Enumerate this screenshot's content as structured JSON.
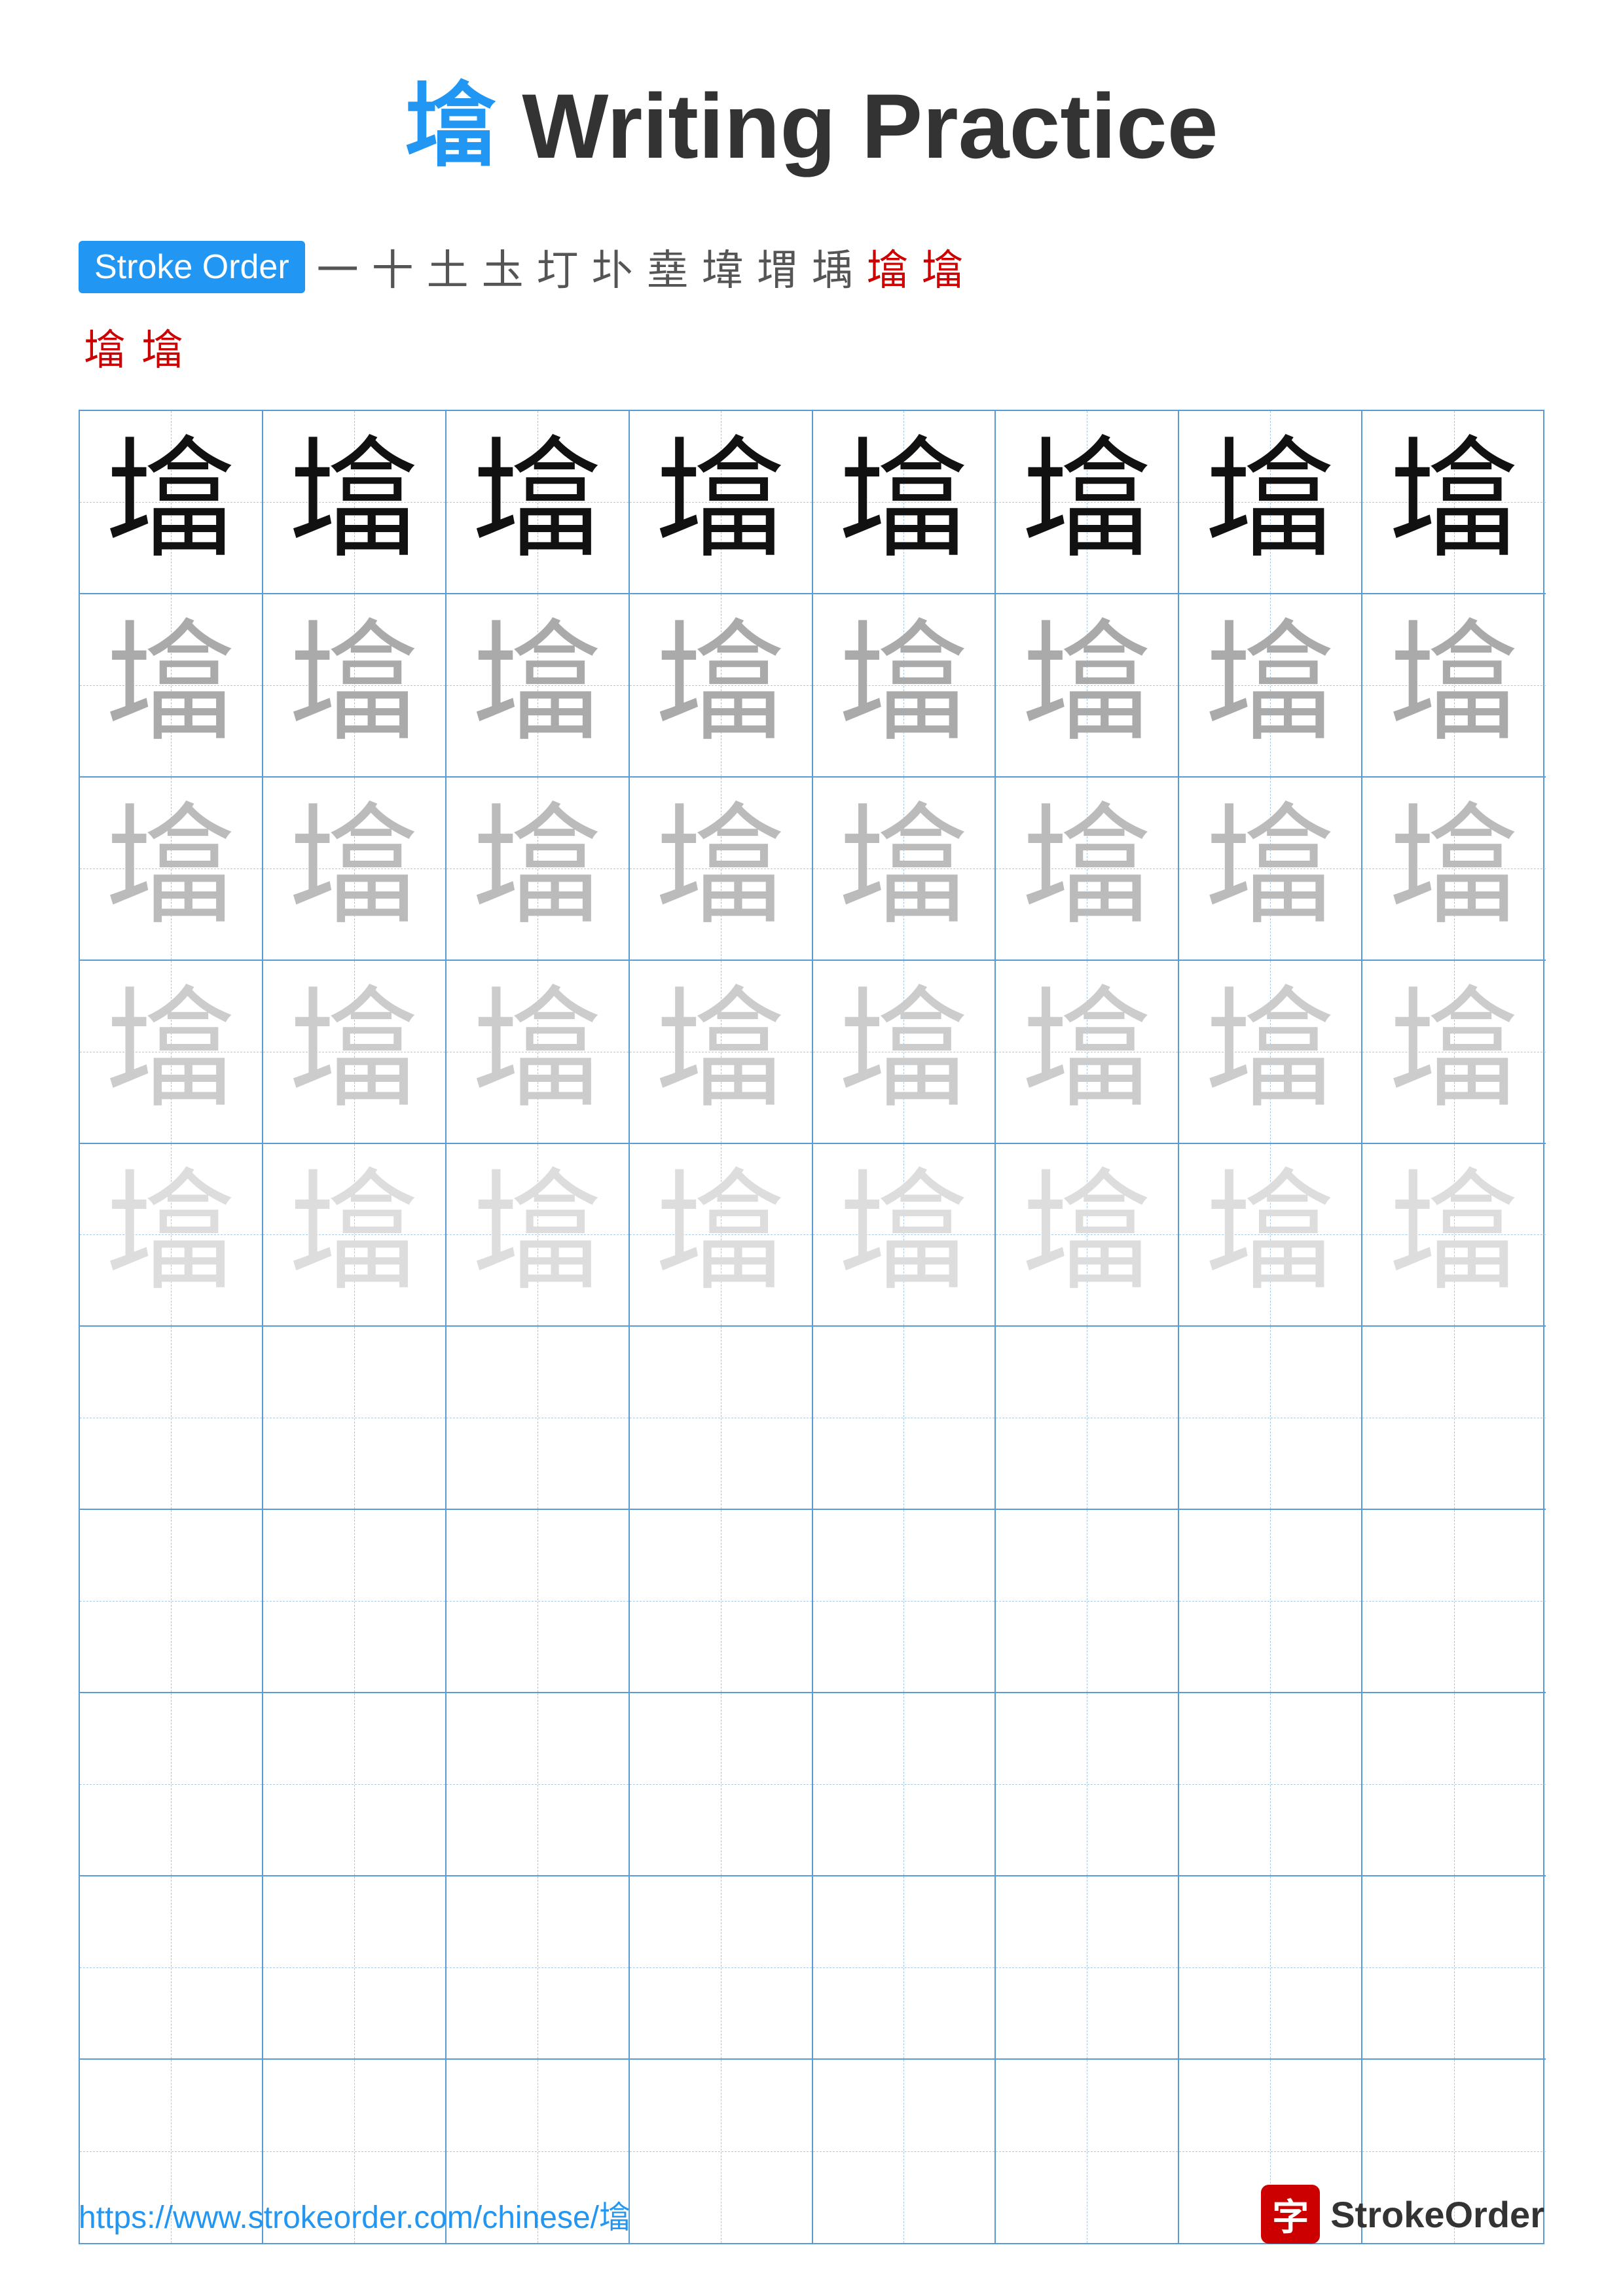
{
  "title": {
    "char": "墖",
    "suffix": " Writing Practice"
  },
  "stroke_order": {
    "label": "Stroke Order",
    "strokes": [
      "一",
      "十",
      "土",
      "圡",
      "圢",
      "圤",
      "㙓",
      "㙔",
      "㙕",
      "㙖",
      "塌",
      "墖"
    ],
    "extra_row": [
      "墖",
      "墖"
    ]
  },
  "grid": {
    "rows": 10,
    "cols": 8,
    "char": "墖",
    "opacities_by_row": [
      [
        "solid",
        "solid",
        "solid",
        "solid",
        "solid",
        "solid",
        "solid",
        "solid"
      ],
      [
        "dark",
        "dark",
        "dark",
        "dark",
        "dark",
        "dark",
        "dark",
        "dark"
      ],
      [
        "medium",
        "medium",
        "medium",
        "medium",
        "medium",
        "medium",
        "medium",
        "medium"
      ],
      [
        "light",
        "light",
        "light",
        "light",
        "light",
        "light",
        "light",
        "light"
      ],
      [
        "verylight",
        "verylight",
        "verylight",
        "verylight",
        "verylight",
        "verylight",
        "verylight",
        "verylight"
      ],
      [
        "empty",
        "empty",
        "empty",
        "empty",
        "empty",
        "empty",
        "empty",
        "empty"
      ],
      [
        "empty",
        "empty",
        "empty",
        "empty",
        "empty",
        "empty",
        "empty",
        "empty"
      ],
      [
        "empty",
        "empty",
        "empty",
        "empty",
        "empty",
        "empty",
        "empty",
        "empty"
      ],
      [
        "empty",
        "empty",
        "empty",
        "empty",
        "empty",
        "empty",
        "empty",
        "empty"
      ],
      [
        "empty",
        "empty",
        "empty",
        "empty",
        "empty",
        "empty",
        "empty",
        "empty"
      ]
    ]
  },
  "footer": {
    "url": "https://www.strokeorder.com/chinese/墖",
    "brand_char": "字",
    "brand_name": "StrokeOrder"
  }
}
